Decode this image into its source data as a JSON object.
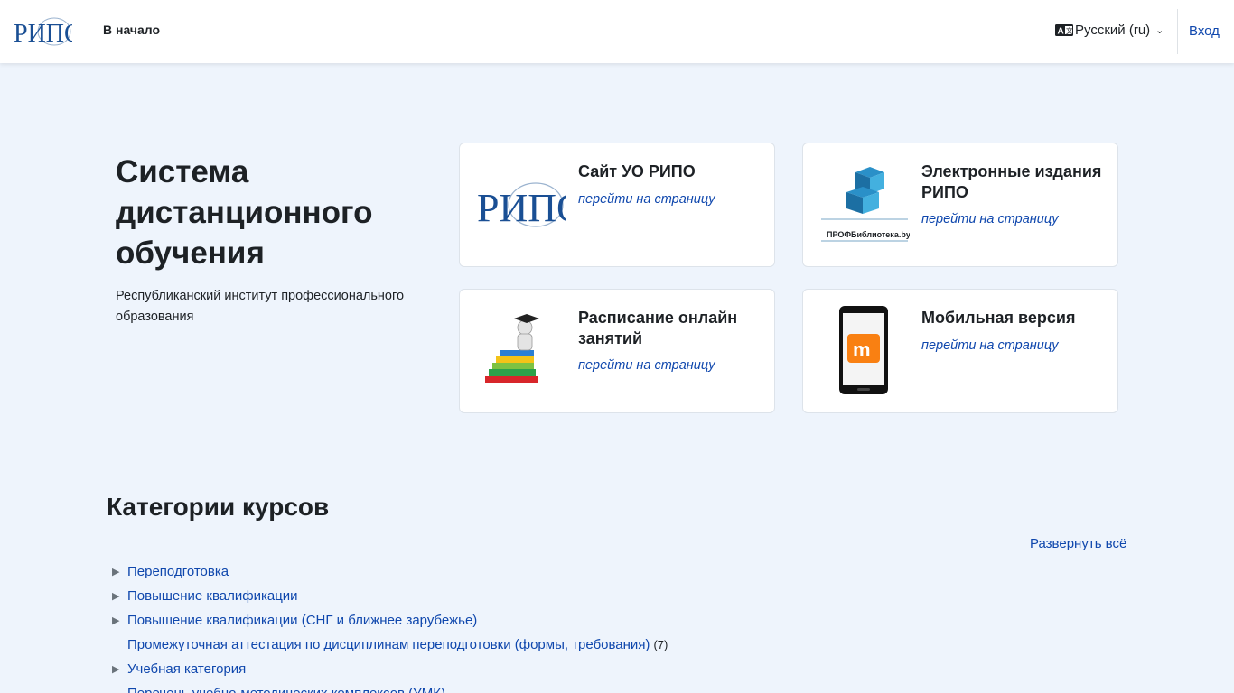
{
  "nav": {
    "logo_text": "РИПО",
    "home": "В начало",
    "language": "Русский (ru)",
    "login": "Вход"
  },
  "hero": {
    "title": "Система дистанционного обучения",
    "subtitle": "Республиканский институт профессионального образования"
  },
  "cards": [
    {
      "title": "Сайт УО РИПО",
      "link": "перейти на страницу",
      "icon": "ripo-logo"
    },
    {
      "title": "Электронные издания РИПО",
      "link": "перейти на страницу",
      "icon": "prof-library-logo",
      "caption": "ПРОФБиблиотека.by"
    },
    {
      "title": "Расписание онлайн занятий",
      "link": "перейти на страницу",
      "icon": "books-graduate-icon"
    },
    {
      "title": "Мобильная версия",
      "link": "перейти на страницу",
      "icon": "mobile-phone-icon"
    }
  ],
  "categories": {
    "heading": "Категории курсов",
    "expand_all": "Развернуть всё",
    "items": [
      {
        "label": "Переподготовка",
        "expandable": true
      },
      {
        "label": "Повышение квалификации",
        "expandable": true
      },
      {
        "label": "Повышение квалификации (СНГ и ближнее зарубежье)",
        "expandable": true
      },
      {
        "label": "Промежуточная аттестация по дисциплинам переподготовки (формы, требования)",
        "count": "(7)",
        "expandable": false
      },
      {
        "label": "Учебная категория",
        "expandable": true
      },
      {
        "label": "Перечень учебно-методических комплексов (УМК)",
        "expandable": false
      }
    ]
  },
  "colors": {
    "link": "#0f47ad",
    "background": "#eef4fc",
    "moodle_orange": "#f98012"
  }
}
